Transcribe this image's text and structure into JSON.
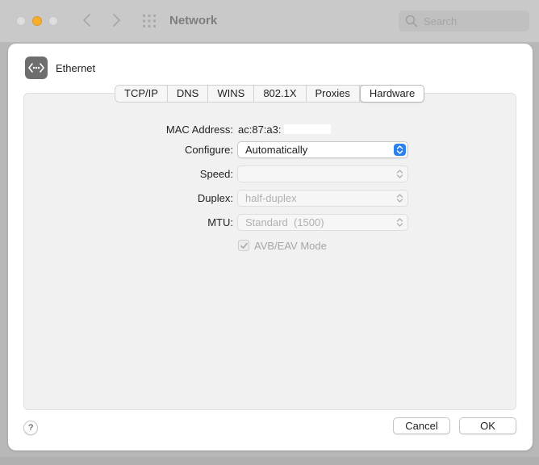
{
  "window": {
    "title": "Network",
    "search_placeholder": "Search"
  },
  "sheet": {
    "service_name": "Ethernet",
    "tabs": [
      {
        "label": "TCP/IP",
        "active": false
      },
      {
        "label": "DNS",
        "active": false
      },
      {
        "label": "WINS",
        "active": false
      },
      {
        "label": "802.1X",
        "active": false
      },
      {
        "label": "Proxies",
        "active": false
      },
      {
        "label": "Hardware",
        "active": true
      }
    ],
    "mac": {
      "label": "MAC Address:",
      "value": "ac:87:a3:"
    },
    "configure": {
      "label": "Configure:",
      "value": "Automatically"
    },
    "speed": {
      "label": "Speed:",
      "value": ""
    },
    "duplex": {
      "label": "Duplex:",
      "value": "half-duplex"
    },
    "mtu": {
      "label": "MTU:",
      "value": "Standard  (1500)"
    },
    "avb": {
      "label": "AVB/EAV Mode",
      "checked": true
    },
    "help_label": "?",
    "cancel_label": "Cancel",
    "ok_label": "OK"
  },
  "colors": {
    "accent": "#2a80f4",
    "traffic_min": "#f6ae2b"
  },
  "icons": [
    "back-arrow-icon",
    "forward-arrow-icon",
    "grid-icon",
    "search-icon",
    "ethernet-icon",
    "chevron-updown-icon",
    "checkmark-icon"
  ]
}
